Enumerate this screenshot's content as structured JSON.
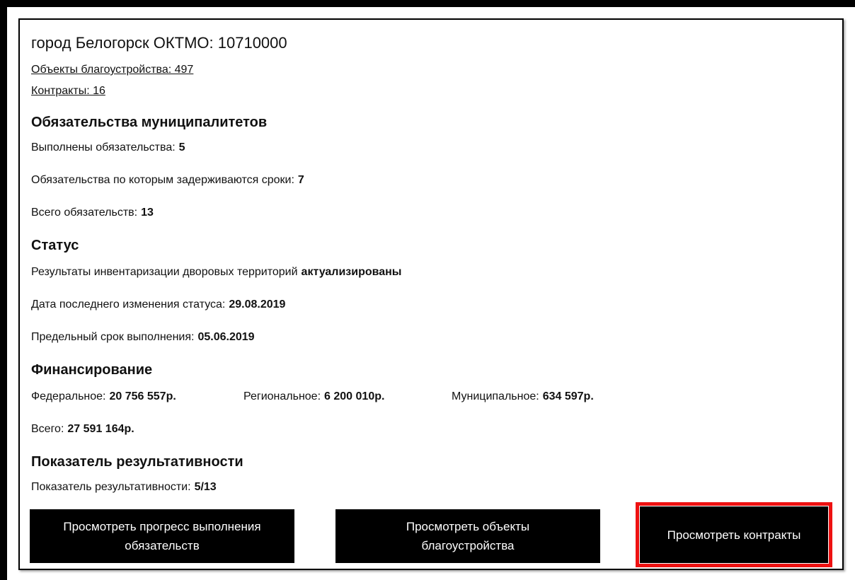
{
  "header": {
    "city": "город Белогорск ОКТМО: 10710000",
    "objects_link": "Объекты благоустройства: 497",
    "contracts_link": "Контракты: 16"
  },
  "obligations": {
    "heading": "Обязательства муниципалитетов",
    "completed_label": "Выполнены обязательства:",
    "completed_value": "5",
    "delayed_label": "Обязательства по которым задерживаются сроки:",
    "delayed_value": "7",
    "total_label": "Всего обязательств:",
    "total_value": "13"
  },
  "status": {
    "heading": "Статус",
    "inventory_label": "Результаты инвентаризации дворовых территорий",
    "inventory_value": "актуализированы",
    "last_change_label": "Дата последнего изменения статуса:",
    "last_change_value": "29.08.2019",
    "deadline_label": "Предельный срок выполнения:",
    "deadline_value": "05.06.2019"
  },
  "funding": {
    "heading": "Финансирование",
    "federal_label": "Федеральное:",
    "federal_value": "20 756 557р.",
    "regional_label": "Региональное:",
    "regional_value": "6 200 010р.",
    "municipal_label": "Муниципальное:",
    "municipal_value": "634 597р.",
    "total_label": "Всего:",
    "total_value": "27 591 164р."
  },
  "performance": {
    "heading": "Показатель результативности",
    "label": "Показатель результативности:",
    "value": "5/13"
  },
  "buttons": {
    "progress_line1": "Просмотреть прогресс выполнения",
    "progress_line2": "обязательств",
    "objects_line1": "Просмотреть объекты",
    "objects_line2": "благоустройства",
    "contracts": "Просмотреть контракты"
  },
  "colors": {
    "button_bg": "#000000",
    "button_text": "#ffffff",
    "highlight": "#e11111"
  }
}
